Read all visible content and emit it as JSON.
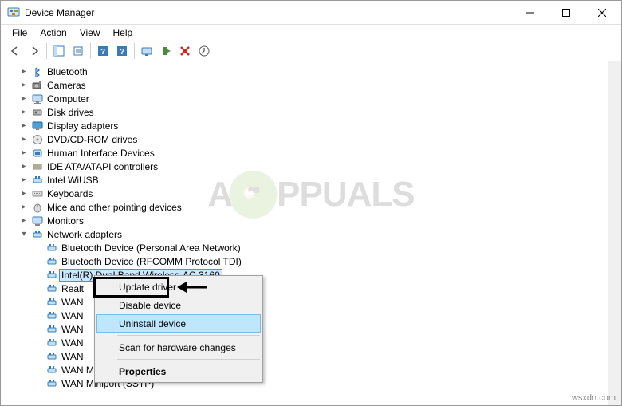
{
  "title": "Device Manager",
  "menubar": [
    "File",
    "Action",
    "View",
    "Help"
  ],
  "categories": [
    {
      "name": "Bluetooth",
      "icon": "bt"
    },
    {
      "name": "Cameras",
      "icon": "camera"
    },
    {
      "name": "Computer",
      "icon": "computer"
    },
    {
      "name": "Disk drives",
      "icon": "disk"
    },
    {
      "name": "Display adapters",
      "icon": "display"
    },
    {
      "name": "DVD/CD-ROM drives",
      "icon": "cd"
    },
    {
      "name": "Human Interface Devices",
      "icon": "hid"
    },
    {
      "name": "IDE ATA/ATAPI controllers",
      "icon": "ide"
    },
    {
      "name": "Intel WiUSB",
      "icon": "net"
    },
    {
      "name": "Keyboards",
      "icon": "keyboard"
    },
    {
      "name": "Mice and other pointing devices",
      "icon": "mouse"
    },
    {
      "name": "Monitors",
      "icon": "monitor"
    }
  ],
  "expanded_category": {
    "name": "Network adapters",
    "icon": "net",
    "children": [
      "Bluetooth Device (Personal Area Network)",
      "Bluetooth Device (RFCOMM Protocol TDI)",
      "Intel(R) Dual Band Wireless-AC 3160",
      "Realt",
      "WAN",
      "WAN",
      "WAN",
      "WAN",
      "WAN",
      "WAN Miniport (PPTP)",
      "WAN Miniport (SSTP)"
    ],
    "selected_index": 2
  },
  "context_menu": {
    "update": "Update driver",
    "disable": "Disable device",
    "uninstall": "Uninstall device",
    "scan": "Scan for hardware changes",
    "properties": "Properties"
  },
  "watermark": {
    "letter": "A",
    "rest": "PPUALS"
  },
  "footer": "wsxdn.com"
}
